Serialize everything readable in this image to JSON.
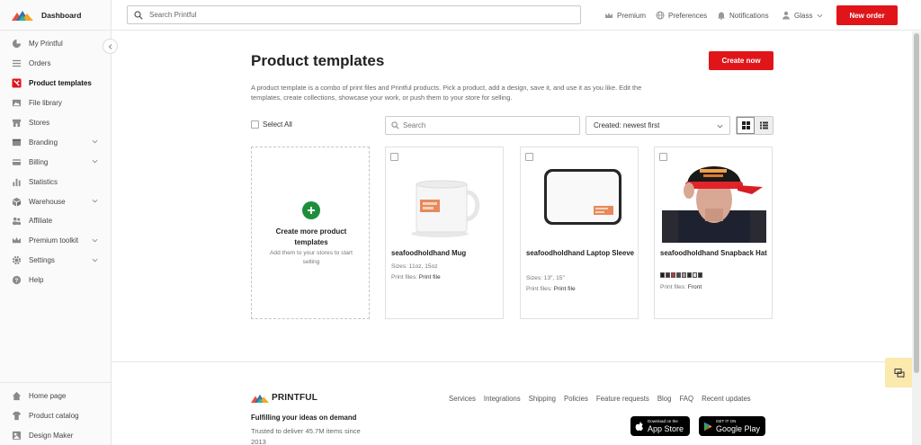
{
  "sidebar": {
    "brand_label": "Dashboard",
    "items": [
      {
        "label": "My Printful"
      },
      {
        "label": "Orders"
      },
      {
        "label": "Product templates"
      },
      {
        "label": "File library"
      },
      {
        "label": "Stores"
      },
      {
        "label": "Branding"
      },
      {
        "label": "Billing"
      },
      {
        "label": "Statistics"
      },
      {
        "label": "Warehouse"
      },
      {
        "label": "Affiliate"
      },
      {
        "label": "Premium toolkit"
      },
      {
        "label": "Settings"
      },
      {
        "label": "Help"
      }
    ],
    "bottom_items": [
      {
        "label": "Home page"
      },
      {
        "label": "Product catalog"
      },
      {
        "label": "Design Maker"
      }
    ]
  },
  "topbar": {
    "search_placeholder": "Search Printful",
    "premium": "Premium",
    "preferences": "Preferences",
    "notifications": "Notifications",
    "user": "Glass",
    "new_order": "New order"
  },
  "main": {
    "title": "Product templates",
    "create_now": "Create now",
    "description": "A product template is a combo of print files and Printful products. Pick a product, add a design, save it, and use it as you like. Edit the templates, create collections, showcase your work, or push them to your store for selling.",
    "select_all": "Select All",
    "search_placeholder": "Search",
    "sort_value": "Created: newest first",
    "add_card": {
      "title": "Create more product templates",
      "subtitle": "Add them to your stores to start selling"
    },
    "cards": [
      {
        "title": "seafoodholdhand Mug",
        "sizes": "Sizes: 11oz, 15oz",
        "print_files_label": "Print files:",
        "print_files": "Print file"
      },
      {
        "title": "seafoodholdhand Laptop Sleeve",
        "sizes": "Sizes: 13″, 15″",
        "print_files_label": "Print files:",
        "print_files": "Print file"
      },
      {
        "title": "seafoodholdhand Snapback Hat",
        "print_files_label": "Print files:",
        "print_files": "Front"
      }
    ]
  },
  "footer": {
    "logo": "PRINTFUL",
    "links": [
      "Services",
      "Integrations",
      "Shipping",
      "Policies",
      "Feature requests",
      "Blog",
      "FAQ",
      "Recent updates"
    ],
    "tagline": "Fulfilling your ideas on demand",
    "trusted": "Trusted to deliver 45.7M items since 2013",
    "app_store_small": "Download on the",
    "app_store_large": "App Store",
    "google_play_small": "GET IT ON",
    "google_play_large": "Google Play"
  },
  "colors": {
    "accent_red": "#e0151a",
    "add_green": "#1d8f3a",
    "chat_bg": "#fbe9ad"
  }
}
